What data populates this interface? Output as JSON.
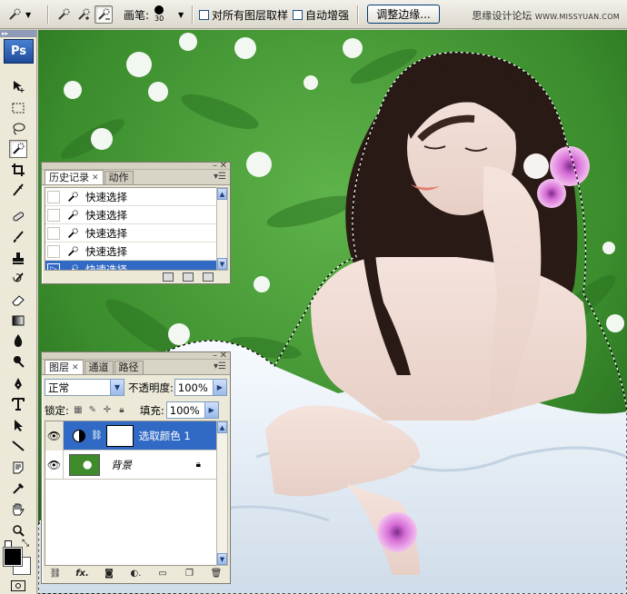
{
  "options_bar": {
    "brush_label": "画笔:",
    "brush_size": "30",
    "sample_all_layers": "对所有图层取样",
    "auto_enhance": "自动增强",
    "refine_edge_button": "调整边缘...",
    "watermark": "思缘设计论坛",
    "watermark_url": "WWW.MISSYUAN.COM"
  },
  "toolbox": {
    "grip": "▸▸",
    "logo": "Ps"
  },
  "history_panel": {
    "tabs": [
      {
        "label": "历史记录",
        "active": true
      },
      {
        "label": "动作",
        "active": false
      }
    ],
    "items": [
      "快速选择",
      "快速选择",
      "快速选择",
      "快速选择",
      "快速选择"
    ],
    "selected_index": 4
  },
  "layers_panel": {
    "tabs": [
      {
        "label": "图层",
        "active": true
      },
      {
        "label": "通道",
        "active": false
      },
      {
        "label": "路径",
        "active": false
      }
    ],
    "blend_mode": "正常",
    "opacity_label": "不透明度:",
    "opacity_value": "100%",
    "lock_label": "锁定:",
    "fill_label": "填充:",
    "fill_value": "100%",
    "layers": [
      {
        "name": "选取颜色 1",
        "selected": true
      },
      {
        "name": "背景",
        "selected": false
      }
    ]
  }
}
